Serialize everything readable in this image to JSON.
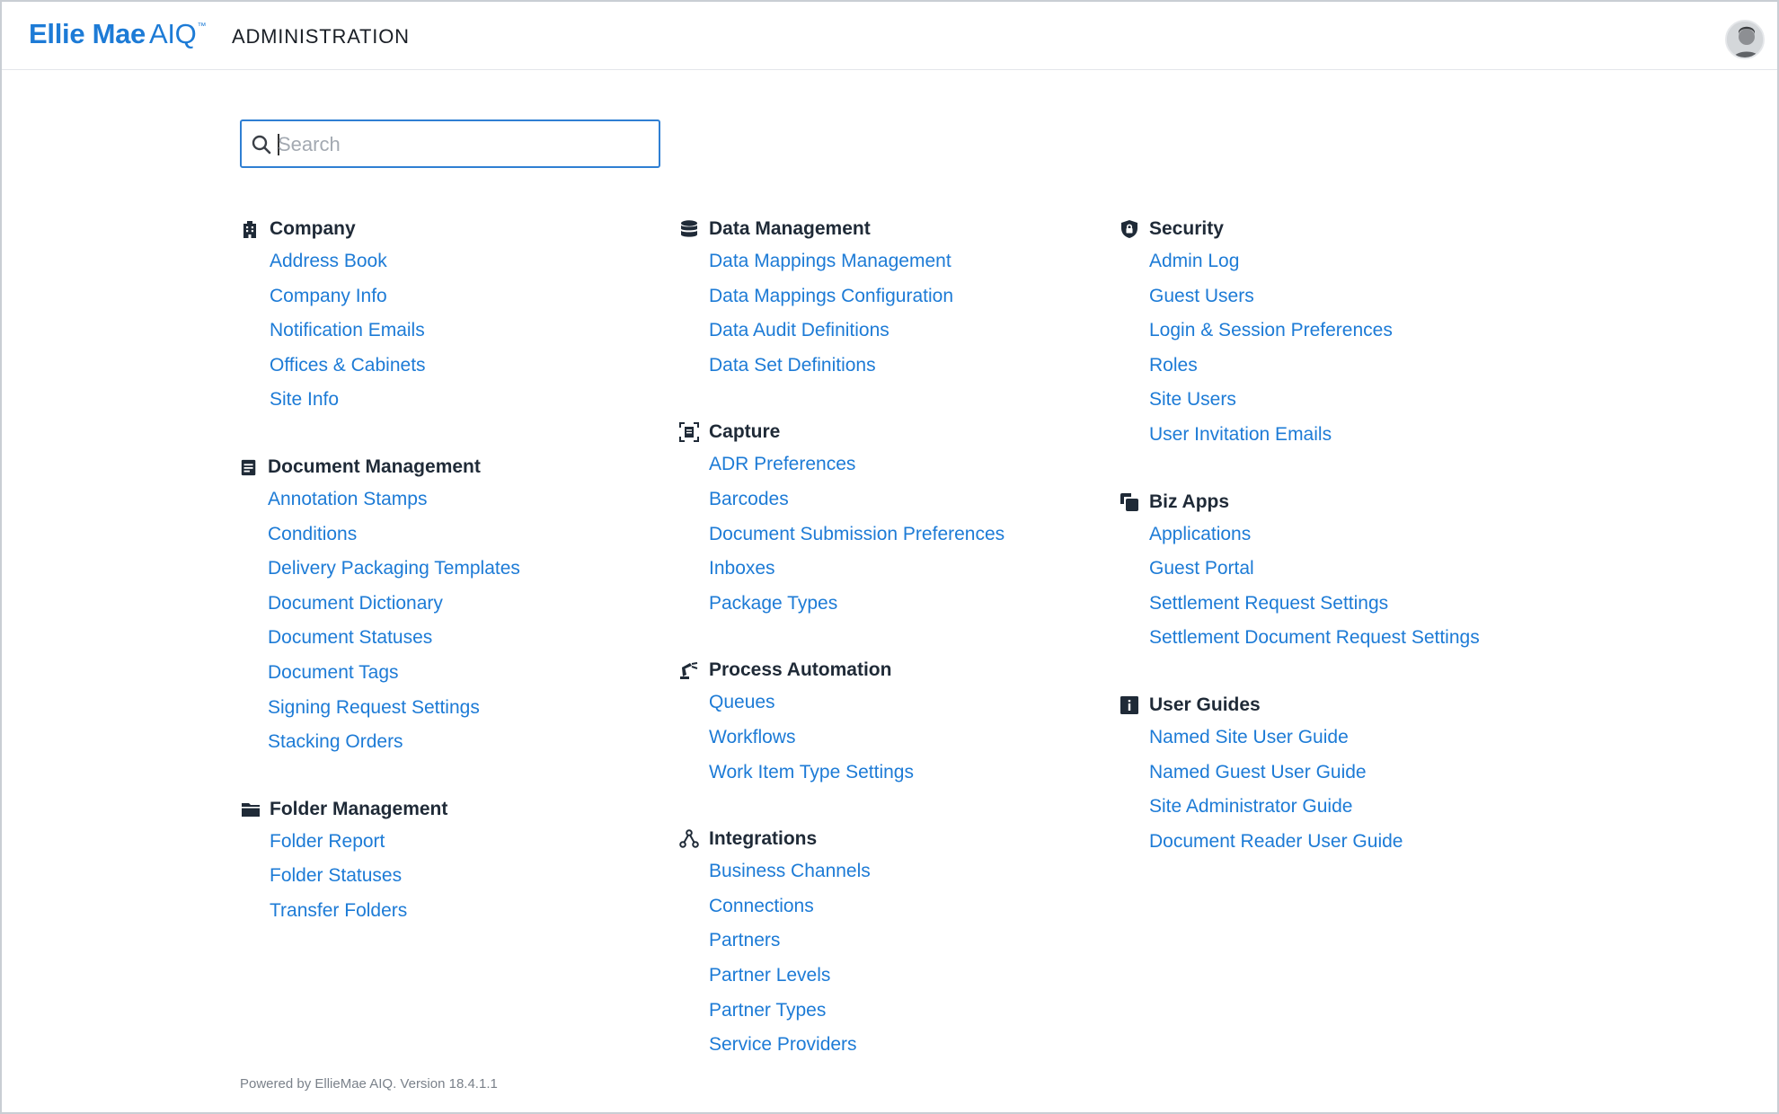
{
  "header": {
    "brand": "Ellie Mae",
    "brand_suffix": "AIQ",
    "brand_tm": "™",
    "app_title": "ADMINISTRATION",
    "avatar_icon": "user-avatar"
  },
  "search": {
    "placeholder": "Search",
    "value": "",
    "icon": "search-icon"
  },
  "columns": [
    {
      "sections": [
        {
          "title": "Company",
          "icon": "building-icon",
          "links": [
            "Address Book",
            "Company Info",
            "Notification Emails",
            "Offices & Cabinets",
            "Site Info"
          ]
        },
        {
          "title": "Document Management",
          "icon": "document-icon",
          "links": [
            "Annotation Stamps",
            "Conditions",
            "Delivery Packaging Templates",
            "Document Dictionary",
            "Document Statuses",
            "Document Tags",
            "Signing Request Settings",
            "Stacking Orders"
          ]
        },
        {
          "title": "Folder Management",
          "icon": "folder-icon",
          "links": [
            "Folder Report",
            "Folder Statuses",
            "Transfer Folders"
          ]
        }
      ]
    },
    {
      "sections": [
        {
          "title": "Data Management",
          "icon": "database-icon",
          "links": [
            "Data Mappings Management",
            "Data Mappings Configuration",
            "Data Audit Definitions",
            "Data Set Definitions"
          ]
        },
        {
          "title": "Capture",
          "icon": "capture-icon",
          "links": [
            "ADR Preferences",
            "Barcodes",
            "Document Submission Preferences",
            "Inboxes",
            "Package Types"
          ]
        },
        {
          "title": "Process Automation",
          "icon": "robot-arm-icon",
          "links": [
            "Queues",
            "Workflows",
            "Work Item Type Settings"
          ]
        },
        {
          "title": "Integrations",
          "icon": "integrations-icon",
          "links": [
            "Business Channels",
            "Connections",
            "Partners",
            "Partner Levels",
            "Partner Types",
            "Service Providers"
          ]
        }
      ]
    },
    {
      "sections": [
        {
          "title": "Security",
          "icon": "shield-lock-icon",
          "links": [
            "Admin Log",
            "Guest Users",
            "Login & Session Preferences",
            "Roles",
            "Site Users",
            "User Invitation Emails"
          ]
        },
        {
          "title": "Biz Apps",
          "icon": "apps-icon",
          "links": [
            "Applications",
            "Guest Portal",
            "Settlement Request Settings",
            "Settlement Document Request Settings"
          ]
        },
        {
          "title": "User Guides",
          "icon": "info-icon",
          "links": [
            "Named Site User Guide",
            "Named Guest User Guide",
            "Site Administrator Guide",
            "Document Reader User Guide"
          ]
        }
      ]
    }
  ],
  "footer": {
    "text": "Powered by EllieMae AIQ. Version 18.4.1.1"
  },
  "colors": {
    "accent": "#1d7bd6",
    "heading": "#1f2a37",
    "search_border": "#2f7fd3"
  }
}
